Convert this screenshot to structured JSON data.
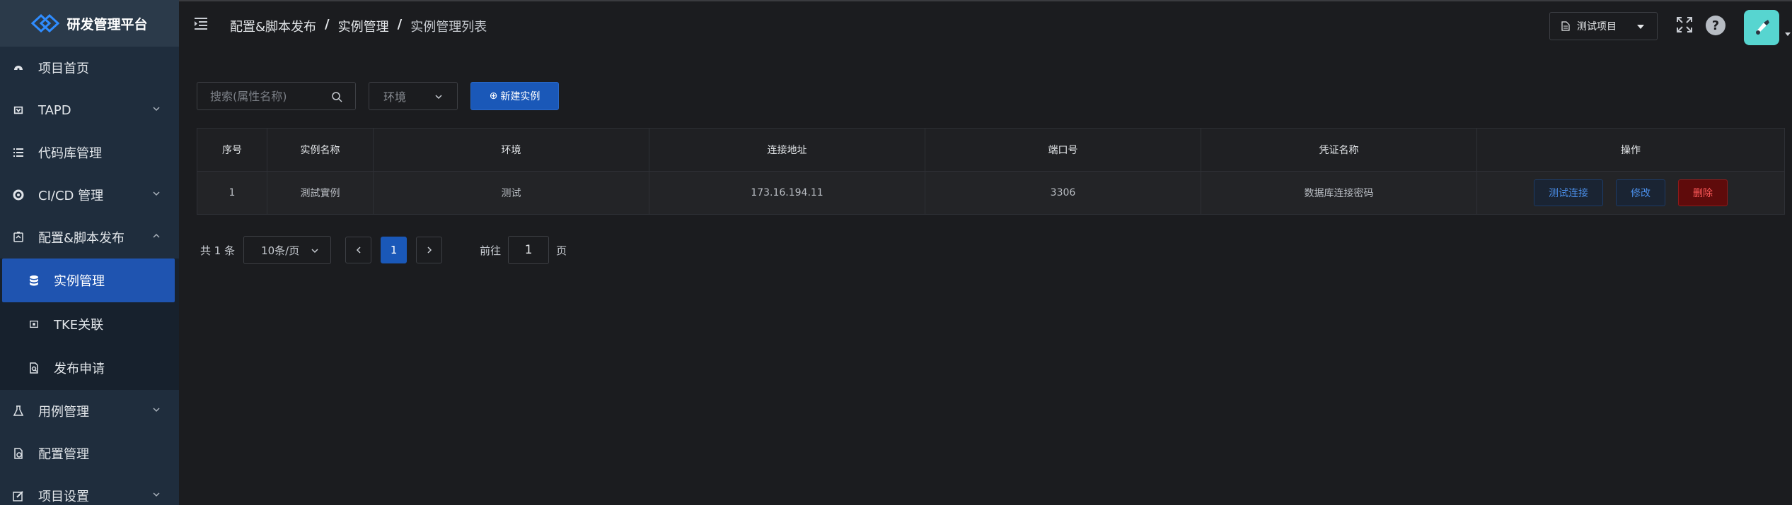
{
  "app": {
    "logo_text": "研发管理平台"
  },
  "sidebar": {
    "items": [
      {
        "label": "项目首页",
        "icon": "dashboard-icon"
      },
      {
        "label": "TAPD",
        "icon": "tapd-icon",
        "expandable": true
      },
      {
        "label": "代码库管理",
        "icon": "list-icon"
      },
      {
        "label": "CI/CD 管理",
        "icon": "cicd-icon",
        "expandable": true
      },
      {
        "label": "配置&脚本发布",
        "icon": "deploy-icon",
        "expanded": true
      },
      {
        "label": "实例管理",
        "icon": "database-icon",
        "active": true,
        "sub": true
      },
      {
        "label": "TKE关联",
        "icon": "tke-icon",
        "sub": true
      },
      {
        "label": "发布申请",
        "icon": "file-search-icon",
        "sub": true
      },
      {
        "label": "用例管理",
        "icon": "flask-icon",
        "expandable": true
      },
      {
        "label": "配置管理",
        "icon": "config-icon"
      },
      {
        "label": "项目设置",
        "icon": "edit-icon",
        "expandable": true
      }
    ]
  },
  "header": {
    "breadcrumb": [
      "配置&脚本发布",
      "实例管理",
      "实例管理列表"
    ],
    "breadcrumb_sep": "/",
    "project": "测试项目",
    "help": "?"
  },
  "toolbar": {
    "search_placeholder": "搜索(属性名称)",
    "env_placeholder": "环境",
    "new_button": "新建实例",
    "new_button_icon": "⊕"
  },
  "table": {
    "columns": [
      "序号",
      "实例名称",
      "环境",
      "连接地址",
      "端口号",
      "凭证名称",
      "操作"
    ],
    "rows": [
      [
        "1",
        "測試實例",
        "测试",
        "173.16.194.11",
        "3306",
        "数据库连接密码"
      ]
    ],
    "actions": {
      "test": "测试连接",
      "edit": "修改",
      "delete": "删除"
    }
  },
  "pagination": {
    "total": "共 1 条",
    "page_size": "10条/页",
    "current": "1",
    "goto_label": "前往",
    "goto_value": "1",
    "goto_suffix": "页"
  },
  "colors": {
    "accent": "#1a58b8",
    "sidebar_bg": "#1f2d3d",
    "danger": "#5f0b0b",
    "avatar": "#57d5d0"
  }
}
